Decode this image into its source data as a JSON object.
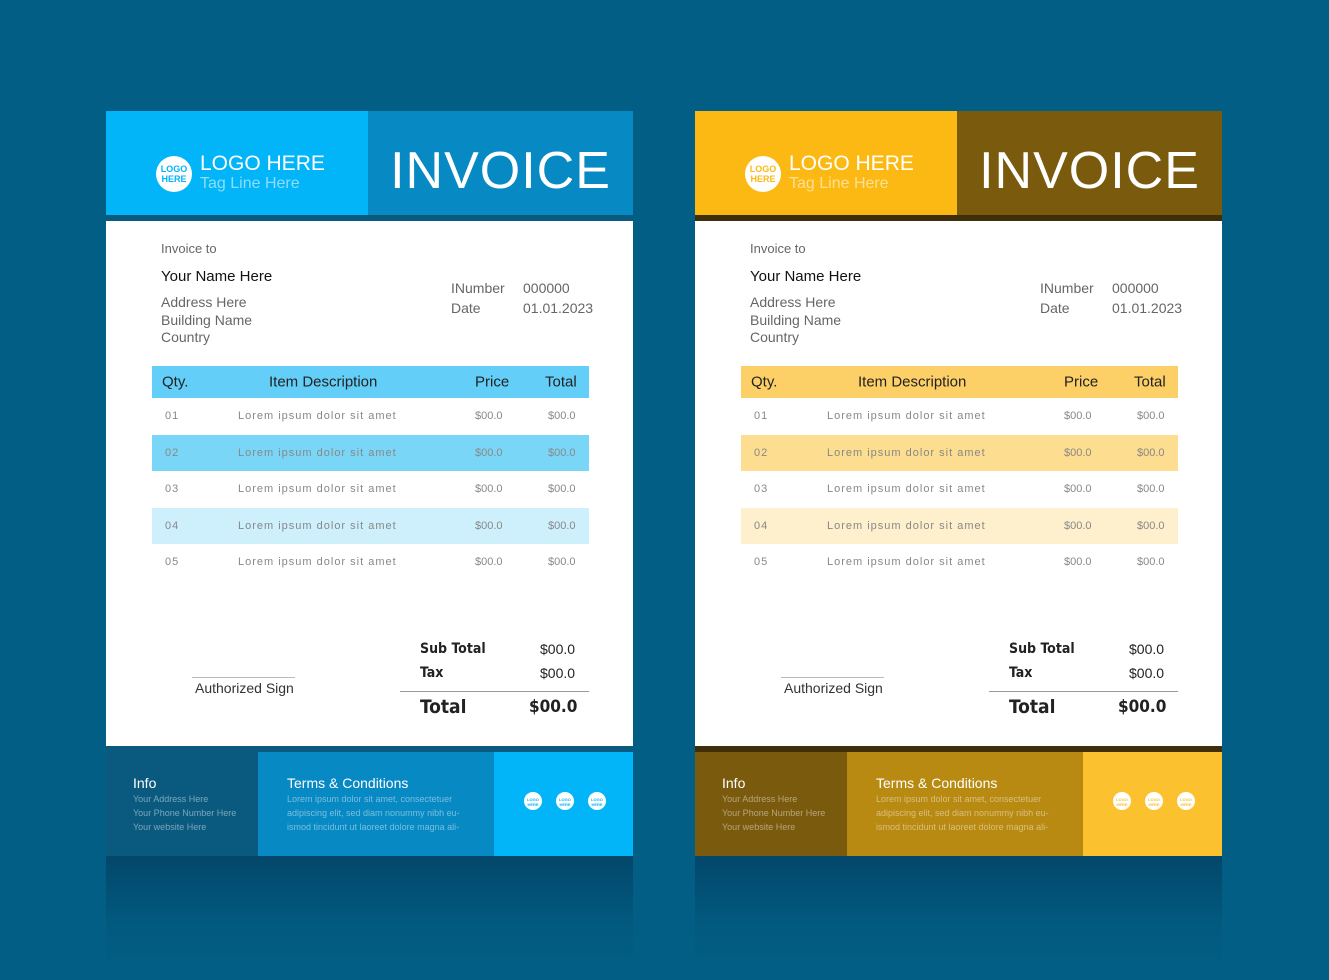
{
  "invoice": {
    "logo_text": "LOGO HERE",
    "logo_badge": "LOGO HERE",
    "tagline": "Tag Line Here",
    "title": "INVOICE",
    "invoice_to_label": "Invoice to",
    "client_name": "Your Name Here",
    "address_lines": [
      "Address Here",
      "Building Name",
      "Country"
    ],
    "number_label": "INumber",
    "number_value": "000000",
    "date_label": "Date",
    "date_value": "01.01.2023",
    "columns": [
      "Qty.",
      "Item Description",
      "Price",
      "Total"
    ],
    "rows": [
      {
        "qty": "01",
        "desc": "Lorem ipsum dolor sit amet",
        "price": "$00.0",
        "total": "$00.0"
      },
      {
        "qty": "02",
        "desc": "Lorem ipsum dolor sit amet",
        "price": "$00.0",
        "total": "$00.0"
      },
      {
        "qty": "03",
        "desc": "Lorem ipsum dolor sit amet",
        "price": "$00.0",
        "total": "$00.0"
      },
      {
        "qty": "04",
        "desc": "Lorem ipsum dolor sit amet",
        "price": "$00.0",
        "total": "$00.0"
      },
      {
        "qty": "05",
        "desc": "Lorem ipsum dolor sit amet",
        "price": "$00.0",
        "total": "$00.0"
      }
    ],
    "subtotal_label": "Sub Total",
    "subtotal_value": "$00.0",
    "tax_label": "Tax",
    "tax_value": "$00.0",
    "total_label": "Total",
    "total_value": "$00.0",
    "sign_label": "Authorized Sign",
    "info_title": "Info",
    "info_lines": [
      "Your Address Here",
      "Your Phone Number Here",
      "Your website Here"
    ],
    "terms_title": "Terms & Conditions",
    "terms_lines": [
      "Lorem ipsum dolor sit amet, consectetuer",
      "adipiscing elit, sed diam nonummy nibh eu-",
      "ismod tincidunt ut laoreet dolore magna ali-"
    ],
    "social_icon_badge": "LOGO HERE"
  },
  "themes": [
    {
      "name": "blue",
      "header_left": "#02b5f9",
      "header_right": "#0789c4",
      "strip": "#0a5a80",
      "table_head": "#63cff8",
      "row_alt": "#7ad6f7",
      "row_alt2": "#cdf0fc",
      "footer_info": "#0a5a80",
      "footer_terms": "#0789c4",
      "footer_icons": "#02b5f9"
    },
    {
      "name": "yellow",
      "header_left": "#fdb913",
      "header_right": "#7a5a0c",
      "strip": "#3e2f0a",
      "table_head": "#fdd067",
      "row_alt": "#fddd8f",
      "row_alt2": "#fef0cc",
      "footer_info": "#7a5a0c",
      "footer_terms": "#b88a11",
      "footer_icons": "#fcc12f"
    }
  ]
}
